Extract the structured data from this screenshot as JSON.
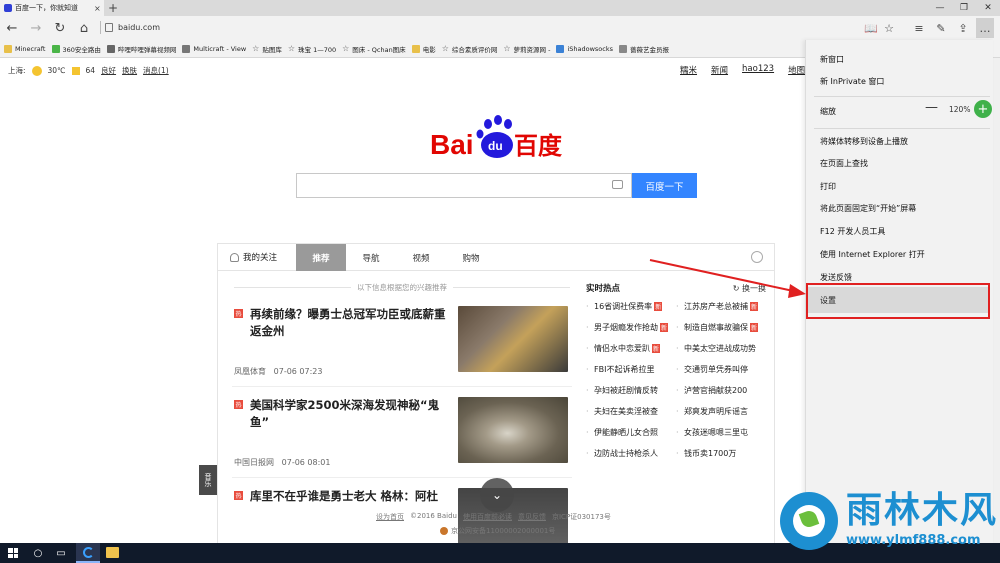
{
  "browser": {
    "tab_title": "百度一下，你就知道",
    "tab_close": "×",
    "new_tab": "+",
    "url": "baidu.com",
    "window_controls": {
      "minimize": "—",
      "restore": "❐",
      "close": "✕"
    },
    "nav_icons": {
      "back": "←",
      "forward": "→",
      "refresh": "↻",
      "home": "⌂"
    },
    "toolbar_icons": {
      "reading_view": "📖",
      "favorite": "☆",
      "hub": "≡",
      "notes": "✎",
      "share": "⇪",
      "more": "…"
    }
  },
  "favorites": [
    {
      "label": "Minecraft",
      "color": "#e8c04a"
    },
    {
      "label": "360安全路由",
      "color": "#4ab548"
    },
    {
      "label": "哔哩哔哩弹幕视频网",
      "color": "#666666"
    },
    {
      "label": "Multicraft - View",
      "color": "#777777"
    },
    {
      "label": "贴图库",
      "color": "star"
    },
    {
      "label": "珠宝 1—700",
      "color": "star"
    },
    {
      "label": "图床 - Qchan图床",
      "color": "star"
    },
    {
      "label": "电影",
      "color": "#e8c04a"
    },
    {
      "label": "综合素质评价网",
      "color": "star"
    },
    {
      "label": "萝莉资源网 -",
      "color": "star"
    },
    {
      "label": "iShadowsocks",
      "color": "#3b82d6"
    },
    {
      "label": "蔷薇艺金员报",
      "color": "#888888"
    }
  ],
  "baidu": {
    "weather": {
      "city": "上海:",
      "temp": "30℃",
      "aqi": "64",
      "level": "良好",
      "skin": "换肤",
      "messages": "消息(1)"
    },
    "top_links": [
      "糯米",
      "新闻",
      "hao123",
      "地图"
    ],
    "logo": {
      "bai": "Bai",
      "du": "du",
      "cn": "百度"
    },
    "search_button": "百度一下",
    "feed": {
      "my_follow": "我的关注",
      "tabs": [
        "推荐",
        "导航",
        "视频",
        "购物"
      ],
      "rec_hint": "以下信息根据您的兴趣推荐",
      "news": [
        {
          "tag": "热",
          "title": "再续前缘？曝勇士总冠军功臣或底薪重返金州",
          "source": "凤凰体育",
          "time": "07-06 07:23"
        },
        {
          "tag": "热",
          "title": "美国科学家2500米深海发现神秘“鬼鱼”",
          "source": "中国日报网",
          "time": "07-06 08:01"
        },
        {
          "tag": "热",
          "title": "库里不在乎谁是勇士老大 格林：阿杜"
        }
      ],
      "hot": {
        "title": "实时热点",
        "change": "换一换",
        "items": [
          {
            "text": "16省调社保费率",
            "badge": "新"
          },
          {
            "text": "江苏房产老总被捕",
            "badge": "新"
          },
          {
            "text": "男子烟瘾发作抢劫",
            "badge": "新"
          },
          {
            "text": "制造自燃事故骗保",
            "badge": "新"
          },
          {
            "text": "情侣水中恋爱趴",
            "badge": "新"
          },
          {
            "text": "中美太空进战成功势",
            "badge": ""
          },
          {
            "text": "FBI不起诉希拉里",
            "badge": ""
          },
          {
            "text": "交通罚单凭券叫停",
            "badge": ""
          },
          {
            "text": "孕妇被赶剧情反转",
            "badge": ""
          },
          {
            "text": "泸营官捐献获200",
            "badge": ""
          },
          {
            "text": "夫妇在美卖淫被查",
            "badge": ""
          },
          {
            "text": "郑爽发声明斥谣言",
            "badge": ""
          },
          {
            "text": "伊能静晒儿女合照",
            "badge": ""
          },
          {
            "text": "女孩迷嗯嗯三里屯",
            "badge": ""
          },
          {
            "text": "边防战士持枪杀人",
            "badge": ""
          },
          {
            "text": "钱币卖1700万",
            "badge": ""
          }
        ]
      },
      "music": "音乐",
      "scroll_icon": "⌄"
    },
    "footer": {
      "set_home": "设为首页",
      "copyright": "©2016 Baidu",
      "terms": "使用百度前必读",
      "feedback": "意见反馈",
      "icp": "京ICP证030173号",
      "police": "京公网安备11000002000001号"
    }
  },
  "menu": {
    "items_top": [
      "新窗口",
      "新 InPrivate 窗口"
    ],
    "zoom_label": "缩放",
    "zoom_minus": "—",
    "zoom_value": "120%",
    "zoom_plus": "+",
    "items_mid": [
      "将媒体转移到设备上播放",
      "在页面上查找",
      "打印",
      "将此页面固定到“开始”屏幕",
      "F12 开发人员工具",
      "使用 Internet Explorer 打开",
      "发送反馈"
    ],
    "settings": "设置"
  },
  "watermark": {
    "title": "雨林木风",
    "url": "www.ylmf888.com"
  },
  "colors": {
    "accent": "#3385ff",
    "highlight": "#e02020",
    "watermark": "#1d8fd1",
    "badge": "#e84c3d"
  }
}
